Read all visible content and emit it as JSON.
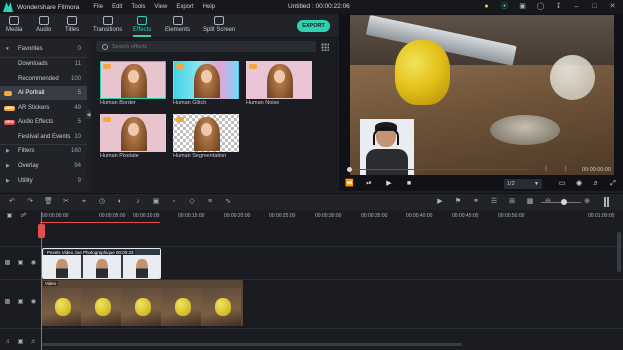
{
  "app": {
    "name": "Wondershare Filmora",
    "doc_title": "Untitled : 00:00:22:06"
  },
  "menu": [
    "File",
    "Edit",
    "Tools",
    "View",
    "Export",
    "Help"
  ],
  "title_icons": [
    "bulb-icon",
    "headset-icon",
    "gift-icon",
    "account-icon",
    "download-icon",
    "minimize-icon",
    "maximize-icon",
    "close-icon"
  ],
  "tabs": [
    {
      "label": "Media",
      "icon": "media-icon"
    },
    {
      "label": "Audio",
      "icon": "audio-icon"
    },
    {
      "label": "Titles",
      "icon": "titles-icon"
    },
    {
      "label": "Transitions",
      "icon": "transitions-icon"
    },
    {
      "label": "Effects",
      "icon": "effects-icon",
      "active": true
    },
    {
      "label": "Elements",
      "icon": "elements-icon"
    },
    {
      "label": "Split Screen",
      "icon": "split-screen-icon"
    }
  ],
  "export_label": "EXPORT",
  "sidebar": [
    {
      "label": "Favorites",
      "count": "0",
      "icon": "heart-icon"
    },
    {
      "label": "Downloads",
      "count": "11"
    },
    {
      "label": "Recommended",
      "count": "100"
    },
    {
      "label": "AI Portrait",
      "count": "5",
      "active": true,
      "badge": "crown"
    },
    {
      "label": "AR Stickers",
      "count": "49",
      "badge": "NEW"
    },
    {
      "label": "Audio Effects",
      "count": "5",
      "badge": "NEW"
    },
    {
      "label": "Festival and Events",
      "count": "10"
    },
    {
      "label": "Filters",
      "count": "160",
      "chevron": true
    },
    {
      "label": "Overlay",
      "count": "94",
      "chevron": true
    },
    {
      "label": "Utility",
      "count": "9",
      "chevron": true
    }
  ],
  "search": {
    "placeholder": "Search effects"
  },
  "effects": [
    {
      "label": "Human Border",
      "style": "pink",
      "selected": true
    },
    {
      "label": "Human Glitch",
      "style": "glitch"
    },
    {
      "label": "Human Noise",
      "style": "noise"
    },
    {
      "label": "Human Pixelate",
      "style": "pink"
    },
    {
      "label": "Human Segmentation",
      "style": "checker"
    }
  ],
  "preview": {
    "timecode": "00:00:00:00",
    "brackets": "{ }",
    "ratio": "1/2",
    "controls": [
      "step-back-icon",
      "play-pause-icon",
      "play-icon",
      "stop-icon"
    ],
    "right_controls": [
      "monitor-icon",
      "snapshot-icon",
      "volume-icon",
      "fullscreen-icon"
    ]
  },
  "timeline": {
    "ticks": [
      "00:00:00:00",
      "00:00:05:00",
      "00:00:10:00",
      "00:00:15:00",
      "00:00:20:00",
      "00:00:25:00",
      "00:00:30:00",
      "00:00:35:00",
      "00:00:40:00",
      "00:00:45:00",
      "00:00:50:00",
      "00:01:00:00"
    ],
    "clip1_name": "Pexels Video Joe Photographique 00:00:23",
    "clip2_name": "Video",
    "tools": [
      "undo-icon",
      "redo-icon",
      "delete-icon",
      "cut-icon",
      "crop-icon",
      "speed-icon",
      "color-icon",
      "audio-mixer-icon",
      "green-screen-icon",
      "stabilize-icon",
      "keyframe-icon",
      "adjust-icon",
      "waveform-icon"
    ],
    "right_tools": [
      "render-icon",
      "marker-icon",
      "voiceover-icon",
      "mixer-icon",
      "snap-icon",
      "pip-icon",
      "zoom-out-icon",
      "zoom-in-icon"
    ]
  },
  "colors": {
    "accent": "#31d1b3",
    "playhead": "#e05050",
    "bg": "#1e1f24",
    "panel": "#222329"
  }
}
